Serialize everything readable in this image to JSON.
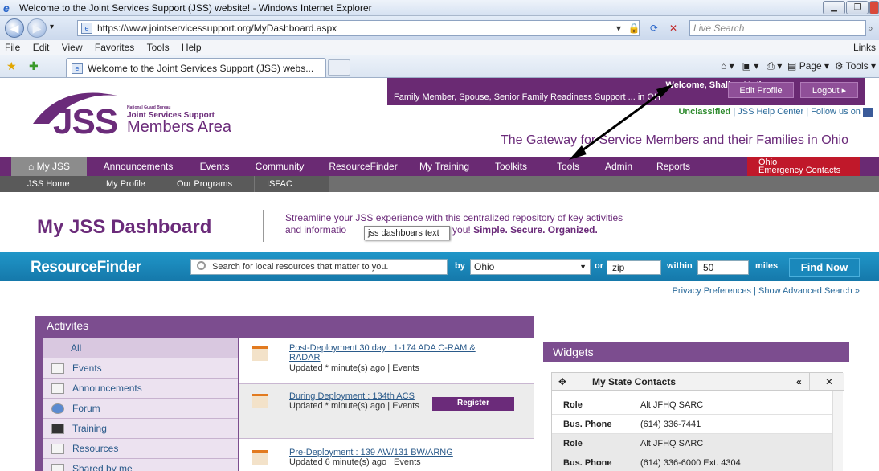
{
  "window": {
    "title": "Welcome to the Joint Services Support (JSS) website! - Windows Internet Explorer",
    "url": "https://www.jointservicessupport.org/MyDashboard.aspx",
    "search_placeholder": "Live Search",
    "menus": [
      "File",
      "Edit",
      "View",
      "Favorites",
      "Tools",
      "Help"
    ],
    "links_label": "Links",
    "tab_title": "Welcome to the Joint Services Support (JSS) webs...",
    "cmd_page": "Page",
    "cmd_tools": "Tools"
  },
  "header": {
    "welcome": "Welcome, Shallon Mathews",
    "role": "Family Member, Spouse, Senior Family Readiness Support ... in OH",
    "edit_profile": "Edit Profile",
    "logout": "Logout",
    "logo_text": "JSS",
    "logo_ngb": "National Guard Bureau",
    "logo_jss": "Joint Services Support",
    "logo_members": "Members Area",
    "unclassified": "Unclassified",
    "help_center": "JSS Help Center",
    "follow_us": "Follow us on",
    "gateway": "The Gateway for Service Members and their Families in Ohio"
  },
  "nav": {
    "items": [
      "My JSS",
      "Announcements",
      "Events",
      "Community",
      "ResourceFinder",
      "My Training",
      "Toolkits",
      "Tools",
      "Admin",
      "Reports"
    ],
    "ohio_line1": "Ohio",
    "ohio_line2": "Emergency Contacts",
    "sub_items": [
      "JSS Home",
      "My Profile",
      "Our Programs",
      "ISFAC"
    ]
  },
  "dashboard": {
    "title": "My JSS Dashboard",
    "desc_line1": "Streamline your JSS experience with this centralized repository of key activities",
    "desc_line2_a": "and informatio",
    "desc_line2_b": "t to you!",
    "desc_line2_bold": "Simple. Secure. Organized.",
    "tooltip": "jss dashboars text"
  },
  "resourcefinder": {
    "title": "ResourceFinder",
    "search_text": "Search for local resources that matter to you.",
    "by_label": "by",
    "state": "Ohio",
    "or_label": "or",
    "zip": "zip",
    "within_label": "within",
    "within_value": "50",
    "miles_label": "miles",
    "find_now": "Find Now",
    "privacy": "Privacy Preferences",
    "advanced": "Show Advanced Search"
  },
  "activities": {
    "title": "Activites",
    "filters": [
      "All",
      "Events",
      "Announcements",
      "Forum",
      "Training",
      "Resources",
      "Shared by me"
    ],
    "feed": [
      {
        "title": "Post-Deployment 30 day : 1-174 ADA C-RAM &",
        "title2": "RADAR",
        "updated": "Updated * minute(s) ago | Events"
      },
      {
        "title": "During Deployment : 134th ACS",
        "title2": "",
        "updated": "Updated * minute(s) ago | Events"
      },
      {
        "title": "Pre-Deployment : 139 AW/131 BW/ARNG",
        "title2": "",
        "updated": "Updated 6 minute(s) ago | Events"
      }
    ],
    "register": "Register"
  },
  "widgets": {
    "title": "Widgets",
    "box_title": "My State Contacts",
    "rows": [
      {
        "k": "Role",
        "v": "Alt JFHQ SARC"
      },
      {
        "k": "Bus. Phone",
        "v": "(614) 336-7441"
      },
      {
        "k": "Role",
        "v": "Alt JFHQ SARC"
      },
      {
        "k": "Bus. Phone",
        "v": "(614) 336-6000 Ext. 4304"
      }
    ]
  }
}
